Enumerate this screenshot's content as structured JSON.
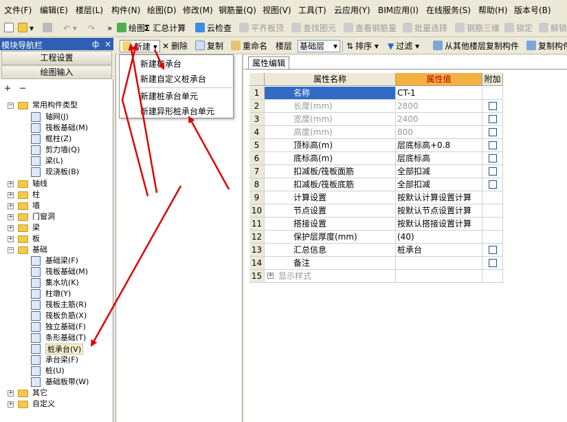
{
  "menu": [
    "文件(F)",
    "编辑(E)",
    "楼层(L)",
    "构件(N)",
    "绘图(D)",
    "修改(M)",
    "钢筋量(Q)",
    "视图(V)",
    "工具(T)",
    "云应用(Y)",
    "BIM应用(I)",
    "在线服务(S)",
    "帮助(H)",
    "版本号(B)"
  ],
  "toolbar": {
    "draw": "绘图",
    "sum": "汇总计算",
    "cloud_check": "云检查",
    "align_top": "平齐板顶",
    "find_element": "查找图元",
    "view_rebar": "查看钢筋量",
    "batch_select": "批量选择",
    "rebar_3d": "钢筋三维",
    "lock": "锁定",
    "unlock": "解锁"
  },
  "nav": {
    "title": "模块导航栏",
    "pin": "ф",
    "close": "×",
    "project_settings": "工程设置",
    "drawing_input": "绘图输入",
    "add": "+",
    "remove": "−",
    "tree": {
      "common": {
        "label": "常用构件类型",
        "items": [
          "轴网(J)",
          "筏板基础(M)",
          "框柱(Z)",
          "剪力墙(Q)",
          "梁(L)",
          "现浇板(B)"
        ]
      },
      "axis": "轴线",
      "column": "柱",
      "wall": "墙",
      "opening": "门窗洞",
      "beam": "梁",
      "slab": "板",
      "foundation": {
        "label": "基础",
        "items": [
          "基础梁(F)",
          "筏板基础(M)",
          "集水坑(K)",
          "柱墩(Y)",
          "筏板主筋(R)",
          "筏板负筋(X)",
          "独立基础(F)",
          "条形基础(T)",
          "桩承台(V)",
          "承台梁(F)",
          "桩(U)",
          "基础板带(W)"
        ]
      },
      "other": "其它",
      "custom": "自定义"
    }
  },
  "midtoolbar": {
    "new": "新建",
    "delete": "删除",
    "copy": "复制",
    "rename": "重命名",
    "floor_label": "楼层",
    "floor_value": "基础层",
    "sort": "排序",
    "filter": "过滤",
    "copy_from_other": "从其他楼层复制构件",
    "copy_to": "复制构件"
  },
  "new_menu": [
    "新建桩承台",
    "新建自定义桩承台",
    "新建桩承台单元",
    "新建异形桩承台单元"
  ],
  "property_editor": {
    "tab": "属性编辑",
    "columns": {
      "name": "属性名称",
      "value": "属性值",
      "extra": "附加"
    },
    "rows": [
      {
        "num": "1",
        "name": "名称",
        "value": "CT-1",
        "checkbox": false,
        "grey": false
      },
      {
        "num": "2",
        "name": "长度(mm)",
        "value": "2800",
        "checkbox": true,
        "grey": true
      },
      {
        "num": "3",
        "name": "宽度(mm)",
        "value": "2400",
        "checkbox": true,
        "grey": true
      },
      {
        "num": "4",
        "name": "高度(mm)",
        "value": "800",
        "checkbox": true,
        "grey": true
      },
      {
        "num": "5",
        "name": "顶标高(m)",
        "value": "层底标高+0.8",
        "checkbox": true,
        "grey": false
      },
      {
        "num": "6",
        "name": "底标高(m)",
        "value": "层底标高",
        "checkbox": true,
        "grey": false
      },
      {
        "num": "7",
        "name": "扣减板/筏板面筋",
        "value": "全部扣减",
        "checkbox": true,
        "grey": false
      },
      {
        "num": "8",
        "name": "扣减板/筏板底筋",
        "value": "全部扣减",
        "checkbox": true,
        "grey": false
      },
      {
        "num": "9",
        "name": "计算设置",
        "value": "按默认计算设置计算",
        "checkbox": false,
        "grey": false
      },
      {
        "num": "10",
        "name": "节点设置",
        "value": "按默认节点设置计算",
        "checkbox": false,
        "grey": false
      },
      {
        "num": "11",
        "name": "搭接设置",
        "value": "按默认搭接设置计算",
        "checkbox": false,
        "grey": false
      },
      {
        "num": "12",
        "name": "保护层厚度(mm)",
        "value": "(40)",
        "checkbox": false,
        "grey": false
      },
      {
        "num": "13",
        "name": "汇总信息",
        "value": "桩承台",
        "checkbox": true,
        "grey": false
      },
      {
        "num": "14",
        "name": "备注",
        "value": "",
        "checkbox": true,
        "grey": false
      },
      {
        "num": "15",
        "name": "显示样式",
        "value": "",
        "checkbox": false,
        "grey": true
      }
    ],
    "expand_symbol": "+"
  },
  "colors": {
    "nav_header": "#2f5fb4",
    "selected_row": "#316ac5",
    "value_header": "#f5b042",
    "arrow": "#e00000"
  }
}
